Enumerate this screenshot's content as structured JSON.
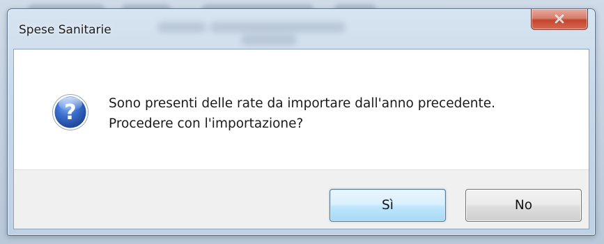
{
  "window": {
    "title": "Spese Sanitarie",
    "close_label": "x"
  },
  "dialog": {
    "message_line1": "Sono presenti delle rate da importare dall'anno precedente.",
    "message_line2": "Procedere con l'importazione?",
    "icon": "question-icon"
  },
  "buttons": {
    "yes_label": "Sì",
    "no_label": "No"
  },
  "colors": {
    "frame": "#c8d8e9",
    "close_button": "#c5442d",
    "default_button_border": "#3c7fb1",
    "button_bar": "#f0f0f0",
    "icon_blue": "#2f5fb8"
  }
}
